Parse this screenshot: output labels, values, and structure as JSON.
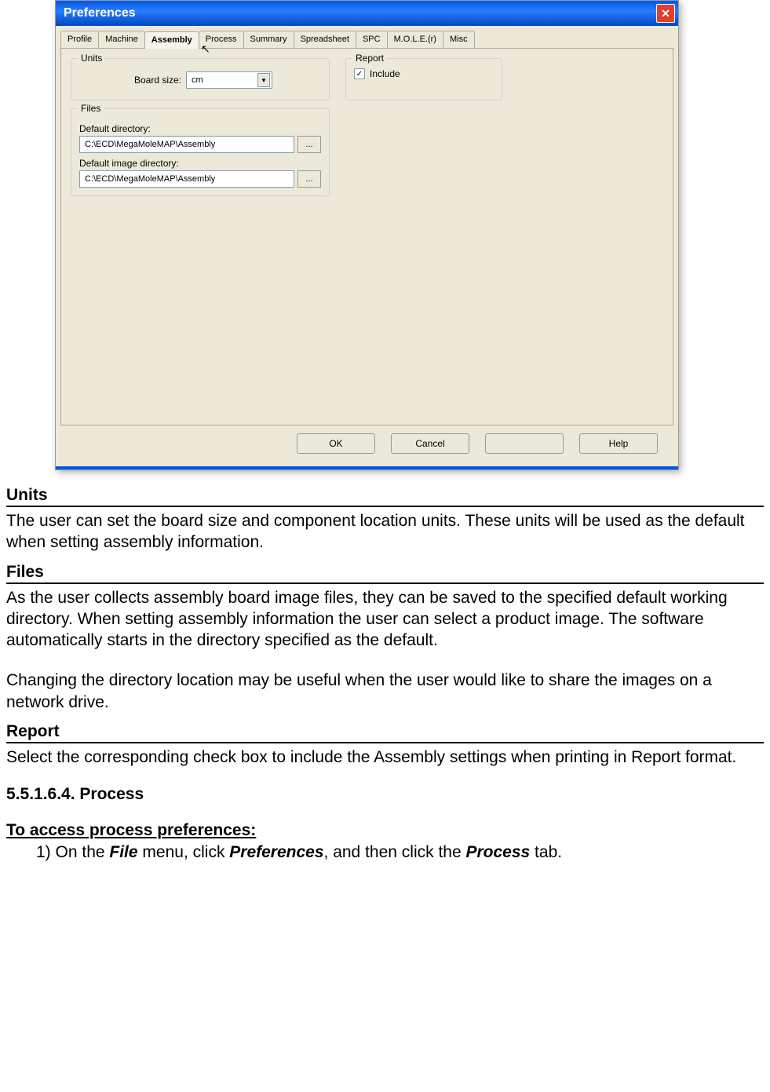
{
  "dialog": {
    "title": "Preferences",
    "tabs": [
      "Profile",
      "Machine",
      "Assembly",
      "Process",
      "Summary",
      "Spreadsheet",
      "SPC",
      "M.O.L.E.(r)",
      "Misc"
    ],
    "active_tab_index": 2,
    "units": {
      "legend": "Units",
      "board_size_label": "Board size:",
      "board_size_value": "cm"
    },
    "report": {
      "legend": "Report",
      "include_label": "Include",
      "include_checked": true
    },
    "files": {
      "legend": "Files",
      "default_dir_label": "Default directory:",
      "default_dir_value": "C:\\ECD\\MegaMoleMAP\\Assembly",
      "default_image_dir_label": "Default image directory:",
      "default_image_dir_value": "C:\\ECD\\MegaMoleMAP\\Assembly",
      "browse_label": "..."
    },
    "buttons": {
      "ok": "OK",
      "cancel": "Cancel",
      "apply": "",
      "help": "Help"
    }
  },
  "doc": {
    "units_heading": "Units",
    "units_para": "The user can set the board size and component location units. These units will be used as the default when setting assembly information.",
    "files_heading": "Files",
    "files_para1": "As the user collects assembly board image files, they can be saved to the specified default working directory. When setting assembly information the user can select a product image. The software automatically starts in the directory specified as the default.",
    "files_para2": "Changing the directory location may be useful when the user would like to share the images on a network drive.",
    "report_heading": "Report",
    "report_para": "Select the corresponding check box to include the Assembly settings when printing in Report format.",
    "process_heading": "5.5.1.6.4. Process",
    "access_heading": "To access process preferences:",
    "step1_prefix": "1) On the ",
    "step1_file": "File",
    "step1_mid1": " menu, click ",
    "step1_prefs": "Preferences",
    "step1_mid2": ", and then click the ",
    "step1_process": "Process",
    "step1_end": " tab."
  }
}
